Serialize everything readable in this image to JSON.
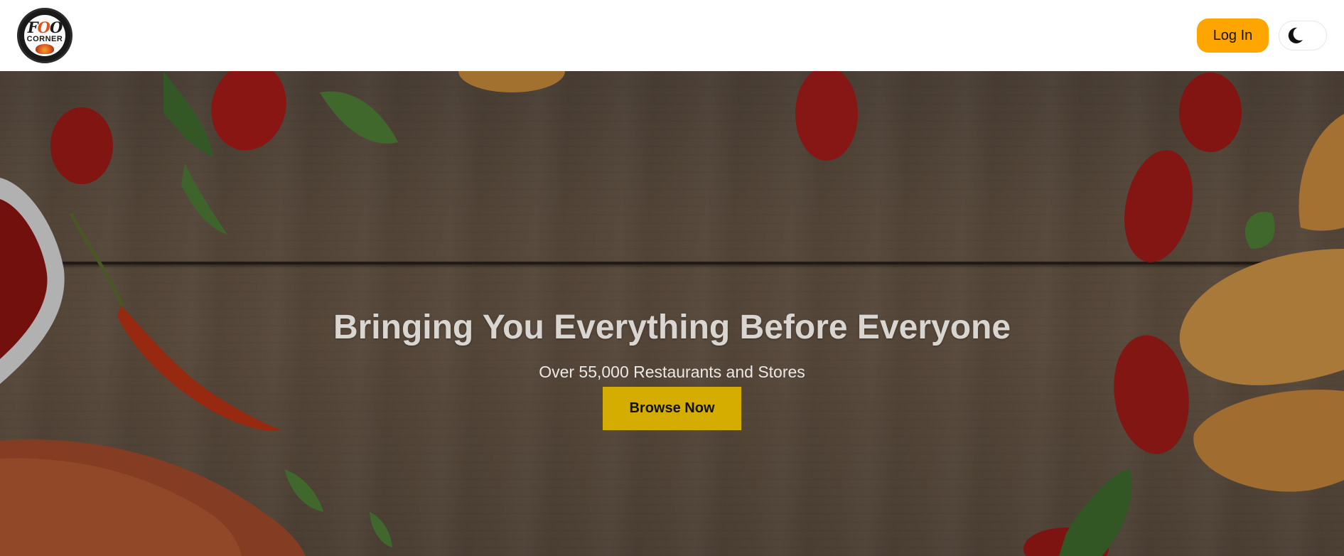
{
  "header": {
    "logo": {
      "line1": "FOOD",
      "line2": "CORNER"
    },
    "login_label": "Log In",
    "theme_toggle_icon": "moon-icon"
  },
  "hero": {
    "title": "Bringing You Everything Before Everyone",
    "subtitle": "Over 55,000 Restaurants and Stores",
    "cta_label": "Browse Now"
  },
  "colors": {
    "login_button": "#ffa500",
    "browse_button": "#d4ad00",
    "header_bg": "#ffffff"
  }
}
